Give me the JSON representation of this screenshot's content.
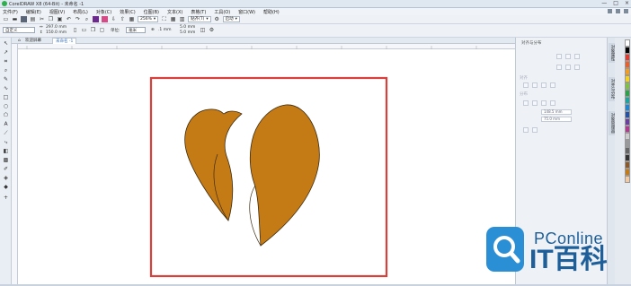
{
  "window": {
    "title": "CorelDRAW X8 (64-Bit) - 未命名 -1",
    "controls": [
      "—",
      "□",
      "×"
    ]
  },
  "menu": {
    "items": [
      "文件(F)",
      "编辑(E)",
      "视图(V)",
      "布局(L)",
      "对象(C)",
      "效果(C)",
      "位图(B)",
      "文本(X)",
      "表格(T)",
      "工具(O)",
      "窗口(W)",
      "帮助(H)"
    ]
  },
  "toolbar": {
    "zoom": "256%",
    "snap_label": "贴齐(T)",
    "launch_label": "启动"
  },
  "property_bar": {
    "page_preset": "自定义",
    "width": "297.0 mm",
    "height": "150.0 mm",
    "units_label": "单位:",
    "units_value": "毫米",
    "nudge": ".1 mm",
    "dup_x": "5.0 mm",
    "dup_y": "5.0 mm"
  },
  "tabs": {
    "welcome": "欢迎屏幕",
    "document": "未命名 -1"
  },
  "docker": {
    "title": "对齐与分布",
    "section_align": "对齐",
    "section_distribute": "分布",
    "field1": "148.5 mm",
    "field2": "75.0 mm"
  },
  "vertical_tabs": [
    "对象属性",
    "对齐与分布",
    "对象管理器"
  ],
  "watermark": {
    "brand": "PConline",
    "name": "IT百科"
  },
  "colors": {
    "heart_fill": "#c57b15",
    "heart_stroke": "#3b2a10",
    "frame": "#d9403c",
    "palette": [
      "#ffffff",
      "#000000",
      "#e33a2f",
      "#e8612c",
      "#f29d1f",
      "#f6d11b",
      "#7fc243",
      "#2ca24a",
      "#1aa5a0",
      "#1f87d2",
      "#2653a6",
      "#6a3f9d",
      "#b03a8f",
      "#cccccc",
      "#999999",
      "#666666",
      "#333333",
      "#8b5a2b",
      "#c57b15",
      "#f2c9a0"
    ]
  }
}
